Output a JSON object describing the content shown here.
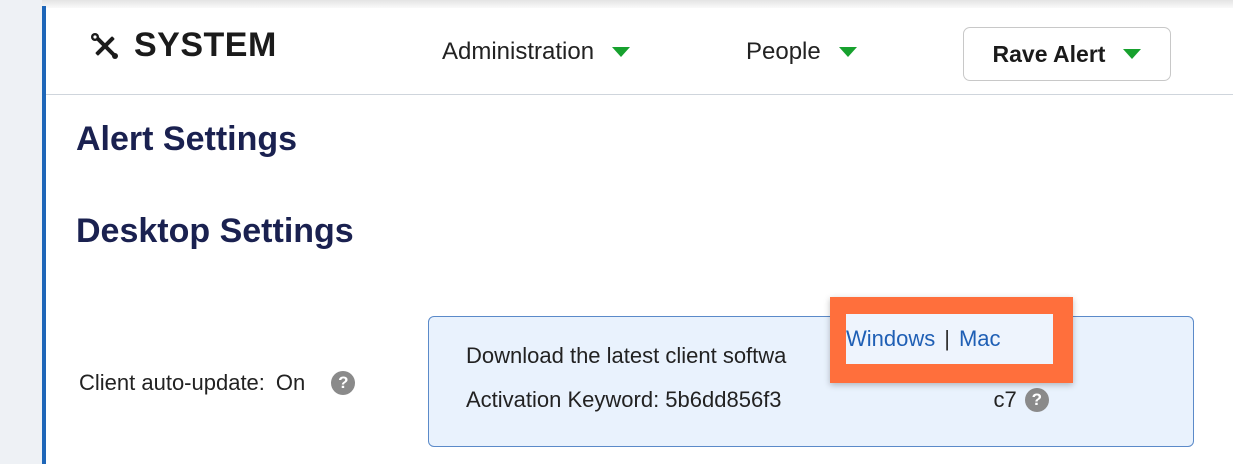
{
  "brand": {
    "icon": "tools-icon",
    "title": "SYSTEM"
  },
  "nav": {
    "items": [
      {
        "label": "Administration"
      },
      {
        "label": "People"
      }
    ],
    "button_label": "Rave Alert",
    "caret_color": "#17a12e"
  },
  "headings": {
    "alert_settings": "Alert Settings",
    "desktop_settings": "Desktop Settings"
  },
  "client_auto_update": {
    "label": "Client auto-update:",
    "value": "On",
    "help_icon": "question-circle-icon"
  },
  "download_box": {
    "text": "Download the latest client softwa",
    "windows_link": "Windows",
    "separator": "|",
    "mac_link": "Mac",
    "activation_label": "Activation Keyword: 5b6dd856f3",
    "activation_tail": "c7",
    "help_icon": "question-circle-icon"
  },
  "colors": {
    "accent_rule": "#1e66b8",
    "heading": "#1a2150",
    "link": "#1f5fb5",
    "highlight": "#ff6f3c",
    "info_bg": "#e9f2fd"
  }
}
